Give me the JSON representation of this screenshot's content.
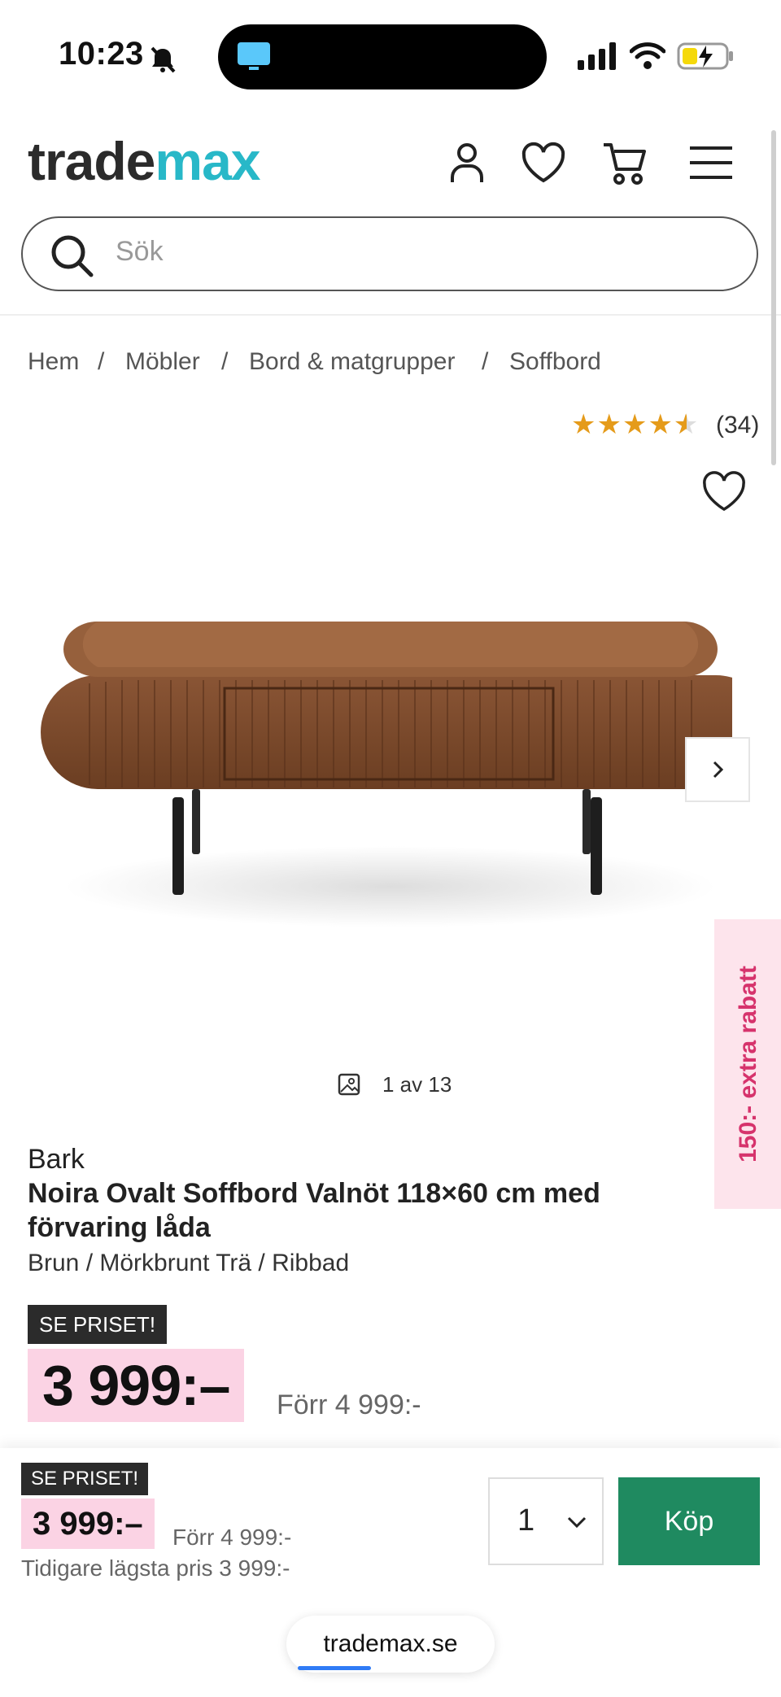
{
  "status_bar": {
    "time": "10:23"
  },
  "header": {
    "logo_part1": "trade",
    "logo_part2": "max",
    "search_placeholder": "Sök"
  },
  "breadcrumb": {
    "items": [
      "Hem",
      "Möbler",
      "Bord & matgrupper",
      "Soffbord"
    ],
    "separator": "/"
  },
  "rating": {
    "stars": 4.5,
    "max": 5,
    "count": "(34)"
  },
  "gallery": {
    "counter": "1 av 13",
    "promo": "150:- extra rabatt"
  },
  "product": {
    "brand": "Bark",
    "title": "Noira Ovalt Soffbord Valnöt 118×60 cm med förvaring låda",
    "variant": "Brun / Mörkbrunt Trä / Ribbad",
    "badge": "SE PRISET!",
    "price": "3 999:–",
    "was_price": "Förr 4 999:-"
  },
  "sticky_bar": {
    "badge": "SE PRISET!",
    "price": "3 999:–",
    "was_price": "Förr 4 999:-",
    "lowest_price": "Tidigare lägsta pris 3 999:-",
    "quantity": "1",
    "buy_label": "Köp"
  },
  "browser": {
    "url": "trademax.se"
  },
  "colors": {
    "brand_teal": "#28b8c8",
    "buy_green": "#1f8a60",
    "price_pink": "#fbd3e4",
    "promo_pink": "#d6336c",
    "star": "#e59b1a"
  }
}
